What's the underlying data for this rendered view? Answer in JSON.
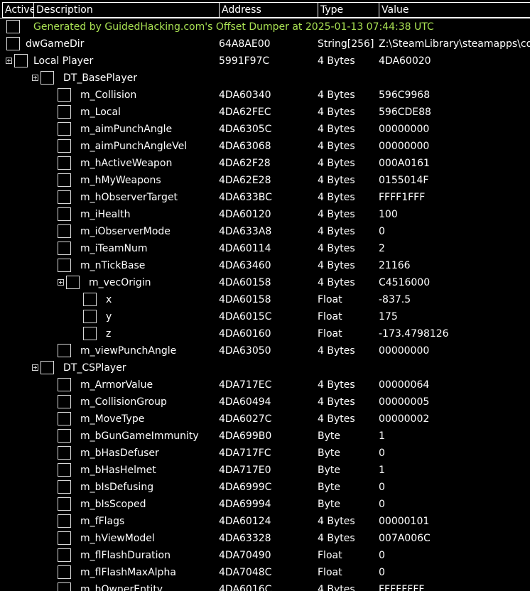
{
  "header": {
    "active": "Active",
    "description": "Description",
    "address": "Address",
    "type": "Type",
    "value": "Value"
  },
  "colors": {
    "background": "#000000",
    "text": "#ffffff",
    "comment_text": "#a8e052"
  },
  "rows": [
    {
      "description": "Generated by GuidedHacking.com's Offset Dumper at 2025-01-13 07:44:38 UTC",
      "address": "",
      "type": "",
      "value": "",
      "comment": true
    },
    {
      "description": "dwGameDir",
      "address": "64A8AE00",
      "type": "String[256]",
      "value": "Z:\\SteamLibrary\\steamapps\\common\\Counter-Strike Global Offensive\\csgo"
    },
    {
      "description": "Local Player",
      "address": "5991F97C",
      "type": "4 Bytes",
      "value": "4DA60020",
      "expander": "plus-icon"
    },
    {
      "description": "DT_BasePlayer",
      "address": "",
      "type": "",
      "value": "",
      "expander": "plus-icon"
    },
    {
      "description": "m_Collision",
      "address": "4DA60340",
      "type": "4 Bytes",
      "value": "596C9968"
    },
    {
      "description": "m_Local",
      "address": "4DA62FEC",
      "type": "4 Bytes",
      "value": "596CDE88"
    },
    {
      "description": "m_aimPunchAngle",
      "address": "4DA6305C",
      "type": "4 Bytes",
      "value": "00000000"
    },
    {
      "description": "m_aimPunchAngleVel",
      "address": "4DA63068",
      "type": "4 Bytes",
      "value": "00000000"
    },
    {
      "description": "m_hActiveWeapon",
      "address": "4DA62F28",
      "type": "4 Bytes",
      "value": "000A0161"
    },
    {
      "description": "m_hMyWeapons",
      "address": "4DA62E28",
      "type": "4 Bytes",
      "value": "0155014F"
    },
    {
      "description": "m_hObserverTarget",
      "address": "4DA633BC",
      "type": "4 Bytes",
      "value": "FFFF1FFF"
    },
    {
      "description": "m_iHealth",
      "address": "4DA60120",
      "type": "4 Bytes",
      "value": "100"
    },
    {
      "description": "m_iObserverMode",
      "address": "4DA633A8",
      "type": "4 Bytes",
      "value": "0"
    },
    {
      "description": "m_iTeamNum",
      "address": "4DA60114",
      "type": "4 Bytes",
      "value": "2"
    },
    {
      "description": "m_nTickBase",
      "address": "4DA63460",
      "type": "4 Bytes",
      "value": "21166"
    },
    {
      "description": "m_vecOrigin",
      "address": "4DA60158",
      "type": "4 Bytes",
      "value": "C4516000",
      "expander": "plus-icon"
    },
    {
      "description": "x",
      "address": "4DA60158",
      "type": "Float",
      "value": "-837.5"
    },
    {
      "description": "y",
      "address": "4DA6015C",
      "type": "Float",
      "value": "175"
    },
    {
      "description": "z",
      "address": "4DA60160",
      "type": "Float",
      "value": "-173.4798126"
    },
    {
      "description": "m_viewPunchAngle",
      "address": "4DA63050",
      "type": "4 Bytes",
      "value": "00000000"
    },
    {
      "description": "DT_CSPlayer",
      "address": "",
      "type": "",
      "value": "",
      "expander": "plus-icon"
    },
    {
      "description": "m_ArmorValue",
      "address": "4DA717EC",
      "type": "4 Bytes",
      "value": "00000064"
    },
    {
      "description": "m_CollisionGroup",
      "address": "4DA60494",
      "type": "4 Bytes",
      "value": "00000005"
    },
    {
      "description": "m_MoveType",
      "address": "4DA6027C",
      "type": "4 Bytes",
      "value": "00000002"
    },
    {
      "description": "m_bGunGameImmunity",
      "address": "4DA699B0",
      "type": "Byte",
      "value": "1"
    },
    {
      "description": "m_bHasDefuser",
      "address": "4DA717FC",
      "type": "Byte",
      "value": "0"
    },
    {
      "description": "m_bHasHelmet",
      "address": "4DA717E0",
      "type": "Byte",
      "value": "1"
    },
    {
      "description": "m_bIsDefusing",
      "address": "4DA6999C",
      "type": "Byte",
      "value": "0"
    },
    {
      "description": "m_bIsScoped",
      "address": "4DA69994",
      "type": "Byte",
      "value": "0"
    },
    {
      "description": "m_fFlags",
      "address": "4DA60124",
      "type": "4 Bytes",
      "value": "00000101"
    },
    {
      "description": "m_hViewModel",
      "address": "4DA63328",
      "type": "4 Bytes",
      "value": "007A006C"
    },
    {
      "description": "m_flFlashDuration",
      "address": "4DA70490",
      "type": "Float",
      "value": "0"
    },
    {
      "description": "m_flFlashMaxAlpha",
      "address": "4DA7048C",
      "type": "Float",
      "value": "0"
    },
    {
      "description": "m_hOwnerEntity",
      "address": "4DA6016C",
      "type": "4 Bytes",
      "value": "FFFFFFFF"
    }
  ]
}
